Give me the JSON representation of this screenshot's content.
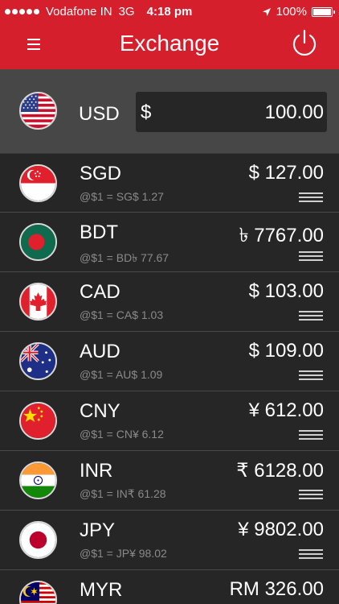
{
  "status_bar": {
    "carrier": "Vodafone IN",
    "network": "3G",
    "time": "4:18 pm",
    "battery": "100%"
  },
  "header": {
    "title": "Exchange",
    "background": "#d61f2c"
  },
  "base_currency": {
    "code": "USD",
    "symbol": "$",
    "amount": "100.00",
    "flag_icon": "us-flag-icon"
  },
  "currencies": [
    {
      "code": "SGD",
      "converted": "$ 127.00",
      "rate": "@$1 = SG$ 1.27",
      "flag_icon": "sg-flag-icon"
    },
    {
      "code": "BDT",
      "converted": "৳ 7767.00",
      "rate": "@$1 = BD৳ 77.67",
      "flag_icon": "bd-flag-icon"
    },
    {
      "code": "CAD",
      "converted": "$ 103.00",
      "rate": "@$1 = CA$ 1.03",
      "flag_icon": "ca-flag-icon"
    },
    {
      "code": "AUD",
      "converted": "$ 109.00",
      "rate": "@$1 = AU$ 1.09",
      "flag_icon": "au-flag-icon"
    },
    {
      "code": "CNY",
      "converted": "¥ 612.00",
      "rate": "@$1 = CN¥ 6.12",
      "flag_icon": "cn-flag-icon"
    },
    {
      "code": "INR",
      "converted": "₹ 6128.00",
      "rate": "@$1 = IN₹ 61.28",
      "flag_icon": "in-flag-icon"
    },
    {
      "code": "JPY",
      "converted": "¥ 9802.00",
      "rate": "@$1 = JP¥ 98.02",
      "flag_icon": "jp-flag-icon"
    },
    {
      "code": "MYR",
      "converted": "RM 326.00",
      "rate": "",
      "flag_icon": "my-flag-icon"
    }
  ]
}
